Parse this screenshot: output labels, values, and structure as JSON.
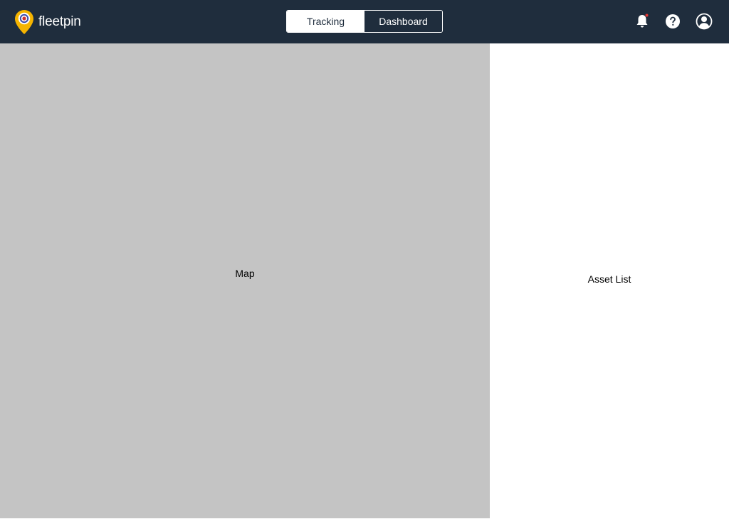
{
  "header": {
    "brand": "fleetpin",
    "tabs": [
      {
        "label": "Tracking",
        "active": true
      },
      {
        "label": "Dashboard",
        "active": false
      }
    ],
    "icons": [
      "bell-icon",
      "help-icon",
      "user-icon"
    ],
    "notification_dot_color": "#e53935"
  },
  "colors": {
    "topbar": "#1f2d3d",
    "logo_pin": "#f5b400",
    "logo_ring_blue": "#3b4ba8",
    "logo_center_red": "#d0312d",
    "map_placeholder": "#c4c4c4"
  },
  "main": {
    "map_label": "Map",
    "asset_list_label": "Asset List"
  }
}
